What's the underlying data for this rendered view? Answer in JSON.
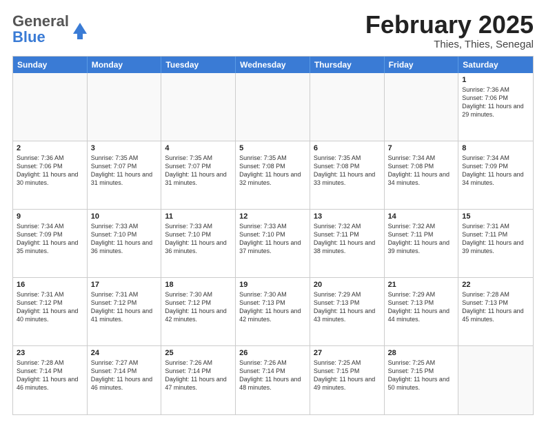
{
  "header": {
    "logo_general": "General",
    "logo_blue": "Blue",
    "month_title": "February 2025",
    "location": "Thies, Thies, Senegal"
  },
  "days_of_week": [
    "Sunday",
    "Monday",
    "Tuesday",
    "Wednesday",
    "Thursday",
    "Friday",
    "Saturday"
  ],
  "weeks": [
    [
      {
        "day": "",
        "text": ""
      },
      {
        "day": "",
        "text": ""
      },
      {
        "day": "",
        "text": ""
      },
      {
        "day": "",
        "text": ""
      },
      {
        "day": "",
        "text": ""
      },
      {
        "day": "",
        "text": ""
      },
      {
        "day": "1",
        "text": "Sunrise: 7:36 AM\nSunset: 7:06 PM\nDaylight: 11 hours and 29 minutes."
      }
    ],
    [
      {
        "day": "2",
        "text": "Sunrise: 7:36 AM\nSunset: 7:06 PM\nDaylight: 11 hours and 30 minutes."
      },
      {
        "day": "3",
        "text": "Sunrise: 7:35 AM\nSunset: 7:07 PM\nDaylight: 11 hours and 31 minutes."
      },
      {
        "day": "4",
        "text": "Sunrise: 7:35 AM\nSunset: 7:07 PM\nDaylight: 11 hours and 31 minutes."
      },
      {
        "day": "5",
        "text": "Sunrise: 7:35 AM\nSunset: 7:08 PM\nDaylight: 11 hours and 32 minutes."
      },
      {
        "day": "6",
        "text": "Sunrise: 7:35 AM\nSunset: 7:08 PM\nDaylight: 11 hours and 33 minutes."
      },
      {
        "day": "7",
        "text": "Sunrise: 7:34 AM\nSunset: 7:08 PM\nDaylight: 11 hours and 34 minutes."
      },
      {
        "day": "8",
        "text": "Sunrise: 7:34 AM\nSunset: 7:09 PM\nDaylight: 11 hours and 34 minutes."
      }
    ],
    [
      {
        "day": "9",
        "text": "Sunrise: 7:34 AM\nSunset: 7:09 PM\nDaylight: 11 hours and 35 minutes."
      },
      {
        "day": "10",
        "text": "Sunrise: 7:33 AM\nSunset: 7:10 PM\nDaylight: 11 hours and 36 minutes."
      },
      {
        "day": "11",
        "text": "Sunrise: 7:33 AM\nSunset: 7:10 PM\nDaylight: 11 hours and 36 minutes."
      },
      {
        "day": "12",
        "text": "Sunrise: 7:33 AM\nSunset: 7:10 PM\nDaylight: 11 hours and 37 minutes."
      },
      {
        "day": "13",
        "text": "Sunrise: 7:32 AM\nSunset: 7:11 PM\nDaylight: 11 hours and 38 minutes."
      },
      {
        "day": "14",
        "text": "Sunrise: 7:32 AM\nSunset: 7:11 PM\nDaylight: 11 hours and 39 minutes."
      },
      {
        "day": "15",
        "text": "Sunrise: 7:31 AM\nSunset: 7:11 PM\nDaylight: 11 hours and 39 minutes."
      }
    ],
    [
      {
        "day": "16",
        "text": "Sunrise: 7:31 AM\nSunset: 7:12 PM\nDaylight: 11 hours and 40 minutes."
      },
      {
        "day": "17",
        "text": "Sunrise: 7:31 AM\nSunset: 7:12 PM\nDaylight: 11 hours and 41 minutes."
      },
      {
        "day": "18",
        "text": "Sunrise: 7:30 AM\nSunset: 7:12 PM\nDaylight: 11 hours and 42 minutes."
      },
      {
        "day": "19",
        "text": "Sunrise: 7:30 AM\nSunset: 7:13 PM\nDaylight: 11 hours and 42 minutes."
      },
      {
        "day": "20",
        "text": "Sunrise: 7:29 AM\nSunset: 7:13 PM\nDaylight: 11 hours and 43 minutes."
      },
      {
        "day": "21",
        "text": "Sunrise: 7:29 AM\nSunset: 7:13 PM\nDaylight: 11 hours and 44 minutes."
      },
      {
        "day": "22",
        "text": "Sunrise: 7:28 AM\nSunset: 7:13 PM\nDaylight: 11 hours and 45 minutes."
      }
    ],
    [
      {
        "day": "23",
        "text": "Sunrise: 7:28 AM\nSunset: 7:14 PM\nDaylight: 11 hours and 46 minutes."
      },
      {
        "day": "24",
        "text": "Sunrise: 7:27 AM\nSunset: 7:14 PM\nDaylight: 11 hours and 46 minutes."
      },
      {
        "day": "25",
        "text": "Sunrise: 7:26 AM\nSunset: 7:14 PM\nDaylight: 11 hours and 47 minutes."
      },
      {
        "day": "26",
        "text": "Sunrise: 7:26 AM\nSunset: 7:14 PM\nDaylight: 11 hours and 48 minutes."
      },
      {
        "day": "27",
        "text": "Sunrise: 7:25 AM\nSunset: 7:15 PM\nDaylight: 11 hours and 49 minutes."
      },
      {
        "day": "28",
        "text": "Sunrise: 7:25 AM\nSunset: 7:15 PM\nDaylight: 11 hours and 50 minutes."
      },
      {
        "day": "",
        "text": ""
      }
    ]
  ]
}
